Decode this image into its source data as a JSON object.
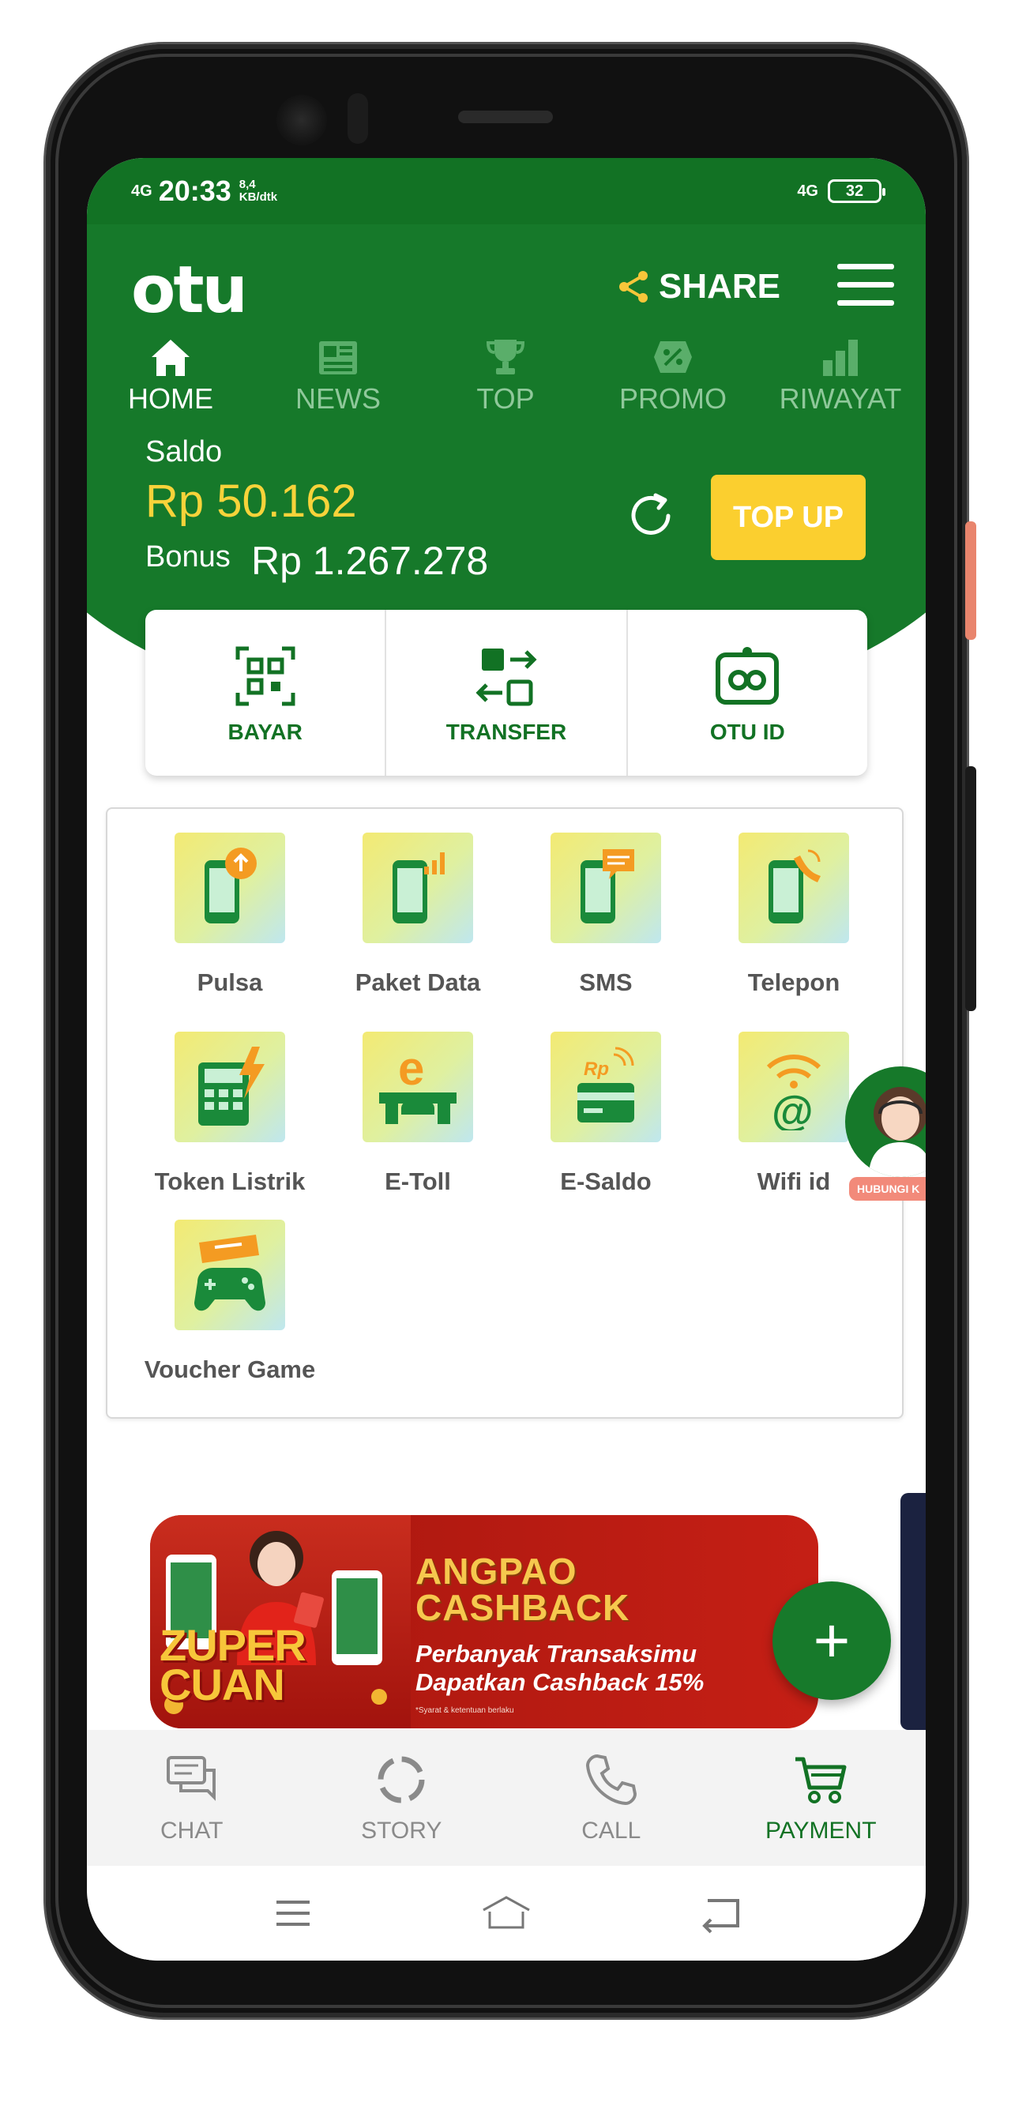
{
  "status_bar": {
    "signal": "4G",
    "time": "20:33",
    "speed_value": "8,4",
    "speed_unit": "KB/dtk",
    "network_right": "4G",
    "battery": "32"
  },
  "header": {
    "logo": "otu",
    "share_label": "SHARE"
  },
  "tabs": [
    {
      "label": "HOME",
      "icon": "home-icon",
      "active": true
    },
    {
      "label": "NEWS",
      "icon": "news-icon",
      "active": false
    },
    {
      "label": "TOP",
      "icon": "trophy-icon",
      "active": false
    },
    {
      "label": "PROMO",
      "icon": "promo-icon",
      "active": false
    },
    {
      "label": "RIWAYAT",
      "icon": "bar-chart-icon",
      "active": false
    }
  ],
  "balance": {
    "saldo_label": "Saldo",
    "saldo_value": "Rp 50.162",
    "bonus_label": "Bonus",
    "bonus_value": "Rp 1.267.278",
    "topup_label": "TOP UP"
  },
  "actions": [
    {
      "label": "BAYAR",
      "icon": "qr-scan-icon"
    },
    {
      "label": "TRANSFER",
      "icon": "transfer-icon"
    },
    {
      "label": "OTU ID",
      "icon": "otu-id-icon"
    }
  ],
  "services": [
    {
      "label": "Pulsa",
      "icon": "phone-credit-icon"
    },
    {
      "label": "Paket Data",
      "icon": "phone-data-icon"
    },
    {
      "label": "SMS",
      "icon": "phone-sms-icon"
    },
    {
      "label": "Telepon",
      "icon": "phone-call-icon"
    },
    {
      "label": "Token Listrik",
      "icon": "electricity-token-icon"
    },
    {
      "label": "E-Toll",
      "icon": "etoll-icon"
    },
    {
      "label": "E-Saldo",
      "icon": "esaldo-icon"
    },
    {
      "label": "Wifi id",
      "icon": "wifi-icon"
    },
    {
      "label": "Voucher Game",
      "icon": "game-voucher-icon"
    }
  ],
  "support": {
    "tag": "HUBUNGI K"
  },
  "banner": {
    "brand_line1": "ZUPER",
    "brand_line2": "CUAN",
    "title_line1": "ANGPAO",
    "title_line2": "CASHBACK",
    "sub_line1": "Perbanyak Transaksimu",
    "sub_line2": "Dapatkan Cashback 15%",
    "footnote": "*Syarat & ketentuan berlaku"
  },
  "fab": {
    "label": "+"
  },
  "bottom_nav": [
    {
      "label": "CHAT",
      "icon": "chat-icon",
      "active": false
    },
    {
      "label": "STORY",
      "icon": "story-icon",
      "active": false
    },
    {
      "label": "CALL",
      "icon": "phone-icon",
      "active": false
    },
    {
      "label": "PAYMENT",
      "icon": "cart-icon",
      "active": true
    }
  ],
  "colors": {
    "brand_green": "#16792a",
    "accent_yellow": "#fbcf2f",
    "saldo_yellow": "#f7d33a",
    "banner_red": "#b31a11"
  }
}
